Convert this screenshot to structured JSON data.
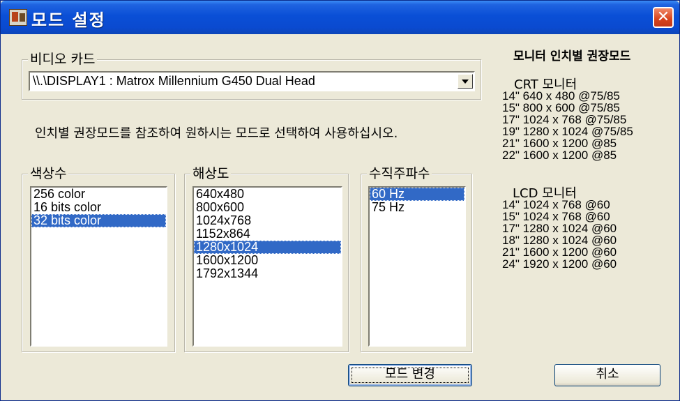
{
  "window": {
    "title": "모드 설정",
    "close_glyph": "✕"
  },
  "video_card": {
    "label": "비디오 카드",
    "selected": "\\\\.\\DISPLAY1 : Matrox Millennium G450 Dual Head"
  },
  "instruction": "인치별 권장모드를 참조하여 원하시는 모드로 선택하여 사용하십시오.",
  "color_depth": {
    "label": "색상수",
    "items": [
      "256 color",
      "16 bits color",
      "32 bits color"
    ],
    "selected_index": 2
  },
  "resolution": {
    "label": "해상도",
    "items": [
      "640x480",
      "800x600",
      "1024x768",
      "1152x864",
      "1280x1024",
      "1600x1200",
      "1792x1344"
    ],
    "selected_index": 4
  },
  "refresh_rate": {
    "label": "수직주파수",
    "items": [
      "60 Hz",
      "75 Hz"
    ],
    "selected_index": 0
  },
  "recommended": {
    "title": "모니터 인치별 권장모드",
    "crt_header": "CRT 모니터",
    "crt_lines": [
      "14\" 640 x 480 @75/85",
      "15\" 800 x 600 @75/85",
      "17\" 1024 x 768 @75/85",
      "19\" 1280 x 1024 @75/85",
      "21\" 1600 x 1200 @85",
      "22\" 1600 x 1200 @85"
    ],
    "lcd_header": "LCD 모니터",
    "lcd_lines": [
      "14\" 1024 x 768 @60",
      "15\" 1024 x 768 @60",
      "17\" 1280 x 1024 @60",
      "18\" 1280 x 1024 @60",
      "21\" 1600 x 1200 @60",
      "24\" 1920 x 1200 @60"
    ]
  },
  "buttons": {
    "apply": "모드 변경",
    "cancel": "취소"
  }
}
